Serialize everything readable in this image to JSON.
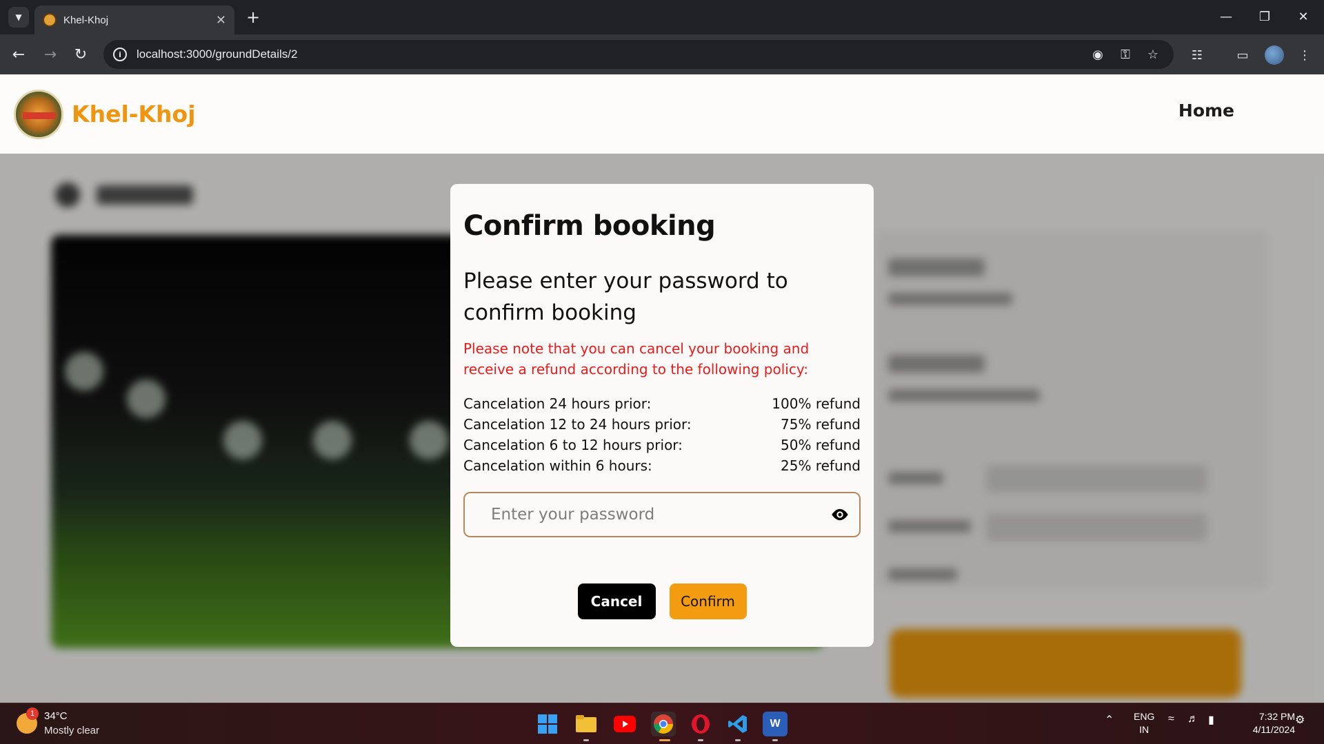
{
  "browser": {
    "tab_title": "Khel-Khoj",
    "url": "localhost:3000/groundDetails/2"
  },
  "site": {
    "brand": "Khel-Khoj",
    "nav_home": "Home",
    "brand_color": "#f0950f"
  },
  "modal": {
    "title": "Confirm booking",
    "subtitle": "Please enter your password to confirm booking",
    "note": "Please note that you can cancel your booking and receive a refund according to the following policy:",
    "policy": [
      {
        "label": "Cancelation 24 hours prior:",
        "value": "100% refund"
      },
      {
        "label": "Cancelation 12 to 24 hours prior:",
        "value": "75% refund"
      },
      {
        "label": "Cancelation 6 to 12 hours prior:",
        "value": "50% refund"
      },
      {
        "label": "Cancelation within 6 hours:",
        "value": "25% refund"
      }
    ],
    "password_placeholder": "Enter your password",
    "password_value": "",
    "cancel_label": "Cancel",
    "confirm_label": "Confirm",
    "note_color": "#ea1b1b",
    "confirm_color": "#f39c12"
  },
  "taskbar": {
    "weather_temp": "34°C",
    "weather_desc": "Mostly clear",
    "weather_badge": "1",
    "lang_line1": "ENG",
    "lang_line2": "IN",
    "time": "7:32 PM",
    "date": "4/11/2024"
  }
}
